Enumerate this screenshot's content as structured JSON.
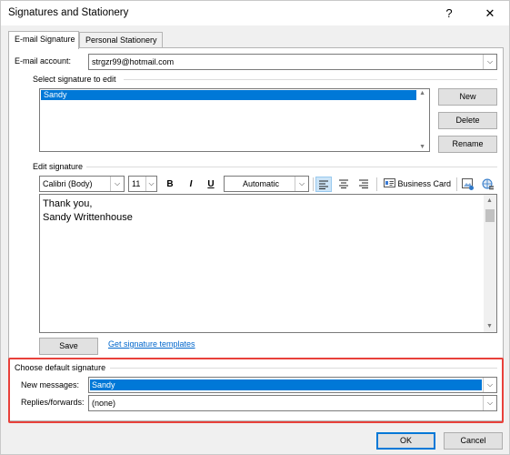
{
  "window": {
    "title": "Signatures and Stationery",
    "help_glyph": "?",
    "close_glyph": "✕"
  },
  "tabs": [
    {
      "label": "E-mail Signature",
      "active": true
    },
    {
      "label": "Personal Stationery",
      "active": false
    }
  ],
  "email_account": {
    "label": "E-mail account:",
    "value": "strgzr99@hotmail.com"
  },
  "select_signature": {
    "label": "Select signature to edit",
    "items": [
      "Sandy"
    ],
    "selected": "Sandy"
  },
  "side_buttons": {
    "new": "New",
    "delete": "Delete",
    "rename": "Rename"
  },
  "edit_signature": {
    "label": "Edit signature",
    "font_name": "Calibri (Body)",
    "font_size": "11",
    "bold": "B",
    "italic": "I",
    "underline": "U",
    "color": "Automatic",
    "business_card": "Business Card",
    "body_lines": [
      "Thank you,",
      "Sandy Writtenhouse"
    ]
  },
  "save_button": "Save",
  "templates_link": "Get signature templates",
  "default_signature": {
    "label": "Choose default signature",
    "new_messages_label": "New messages:",
    "new_messages_value": "Sandy",
    "replies_label": "Replies/forwards:",
    "replies_value": "(none)"
  },
  "footer": {
    "ok": "OK",
    "cancel": "Cancel"
  },
  "colors": {
    "selection": "#0078d7",
    "highlight_box": "#e8413b",
    "link": "#0066cc"
  }
}
